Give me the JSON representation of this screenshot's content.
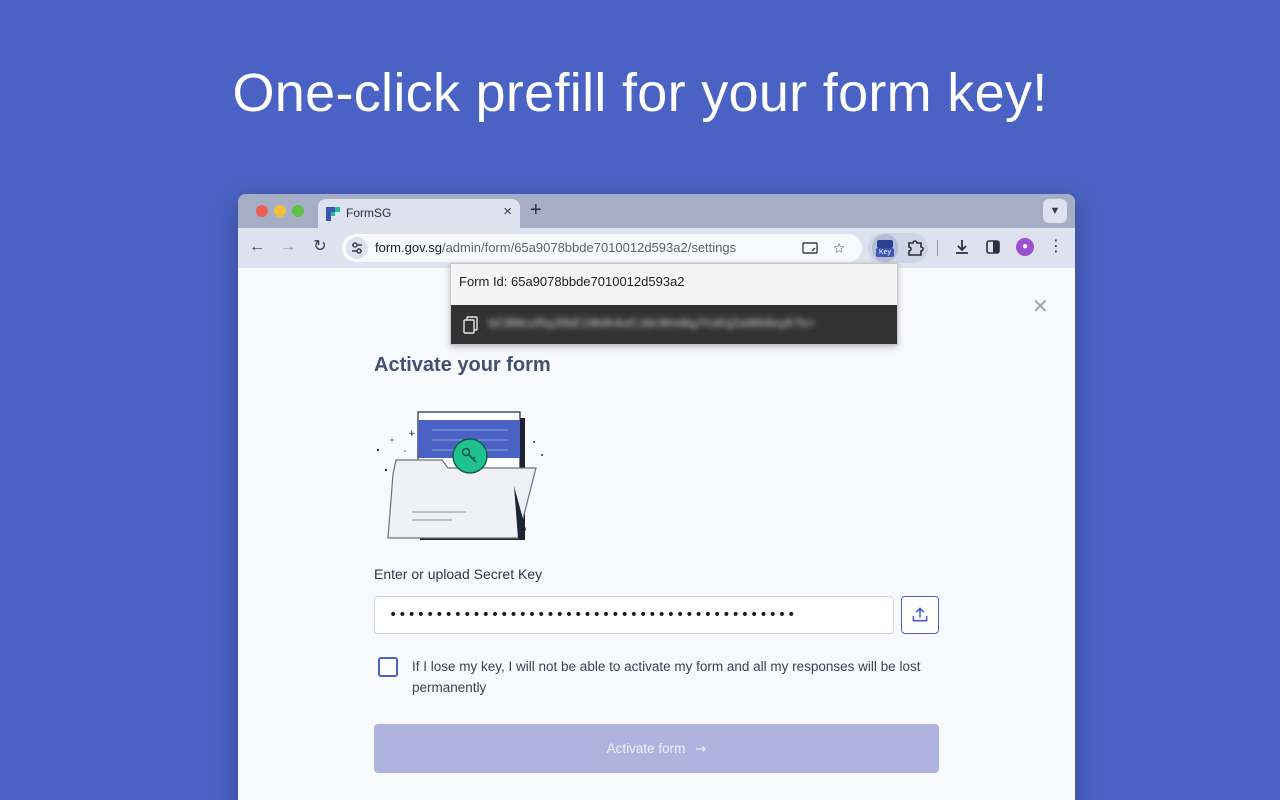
{
  "headline": "One-click prefill for your form key!",
  "browser": {
    "tab": {
      "title": "FormSG",
      "close": "×"
    },
    "new_tab": "+",
    "url_host": "form.gov.sg",
    "url_path": "/admin/form/65a9078bbde7010012d593a2/settings",
    "extension_label": "Key"
  },
  "popup": {
    "form_id_text": "Form Id: 65a9078bbde7010012d593a2",
    "secret_key_masked": "bC8MczRqJ0bE1Wdh4oCJdcWm8qJYuKtj2aWb9xyKTo="
  },
  "form": {
    "close": "✕",
    "title": "Activate your form",
    "secret_label": "Enter or upload Secret Key",
    "secret_value": "••••••••••••••••••••••••••••••••••••••••••••",
    "acknowledgement": "If I lose my key, I will not be able to activate my form and all my responses will be lost permanently",
    "activate_label": "Activate form",
    "activate_arrow": "→"
  },
  "colors": {
    "brand": "#4a62c3",
    "accent_green": "#1fc28f",
    "button_disabled": "#adb5df"
  }
}
